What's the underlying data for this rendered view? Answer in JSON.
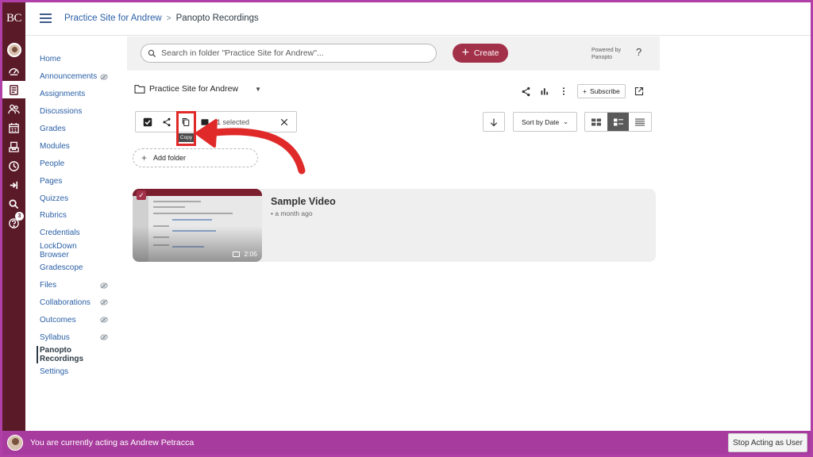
{
  "global_nav": {
    "logo": "BC",
    "help_badge": "3",
    "items": [
      "account-icon",
      "dashboard-icon",
      "courses-icon",
      "groups-icon",
      "calendar-icon",
      "inbox-icon",
      "history-icon",
      "commons-icon",
      "search-icon",
      "help-icon"
    ]
  },
  "header": {
    "breadcrumb_course": "Practice Site for Andrew",
    "breadcrumb_sep": ">",
    "breadcrumb_page": "Panopto Recordings"
  },
  "course_nav": {
    "items": [
      {
        "label": "Home",
        "hidden": false
      },
      {
        "label": "Announcements",
        "hidden": true
      },
      {
        "label": "Assignments",
        "hidden": false
      },
      {
        "label": "Discussions",
        "hidden": false
      },
      {
        "label": "Grades",
        "hidden": false
      },
      {
        "label": "Modules",
        "hidden": false
      },
      {
        "label": "People",
        "hidden": false
      },
      {
        "label": "Pages",
        "hidden": false
      },
      {
        "label": "Quizzes",
        "hidden": false
      },
      {
        "label": "Rubrics",
        "hidden": false
      },
      {
        "label": "Credentials",
        "hidden": false
      },
      {
        "label": "LockDown Browser",
        "hidden": false
      },
      {
        "label": "Gradescope",
        "hidden": false
      },
      {
        "label": "Files",
        "hidden": true
      },
      {
        "label": "Collaborations",
        "hidden": true
      },
      {
        "label": "Outcomes",
        "hidden": true
      },
      {
        "label": "Syllabus",
        "hidden": true
      },
      {
        "label": "Panopto Recordings",
        "hidden": false,
        "active": true
      },
      {
        "label": "Settings",
        "hidden": false
      }
    ]
  },
  "panopto": {
    "search_placeholder": "Search in folder \"Practice Site for Andrew\"...",
    "create_label": "Create",
    "powered_line1": "Powered by",
    "powered_line2": "Panopto",
    "help_label": "?",
    "folder_name": "Practice Site for Andrew",
    "subscribe_label": "Subscribe",
    "selected_text": "1 selected",
    "copy_tooltip": "Copy",
    "sort_label": "Sort by Date",
    "add_folder_label": "Add folder",
    "video": {
      "title": "Sample Video",
      "meta": "a month ago",
      "duration": "2:05"
    }
  },
  "acting_bar": {
    "text": "You are currently acting as Andrew Petracca",
    "stop_label": "Stop Acting as User"
  },
  "colors": {
    "nav_bg": "#5a1a28",
    "accent": "#a33049",
    "acting_bar": "#a83c9e",
    "highlight": "#e02a2a",
    "link": "#2a5fa6"
  }
}
